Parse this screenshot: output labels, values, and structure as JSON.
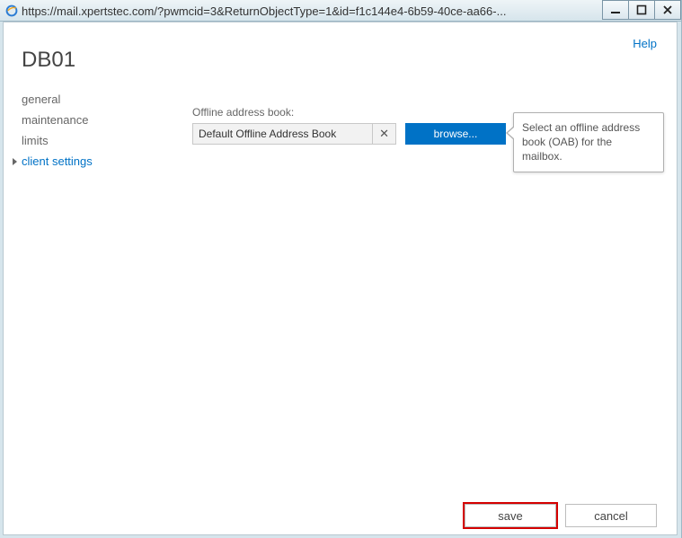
{
  "window": {
    "url": "https://mail.xpertstec.com/?pwmcid=3&ReturnObjectType=1&id=f1c144e4-6b59-40ce-aa66-..."
  },
  "help": {
    "label": "Help"
  },
  "page": {
    "title": "DB01"
  },
  "nav": {
    "items": [
      {
        "label": "general"
      },
      {
        "label": "maintenance"
      },
      {
        "label": "limits"
      },
      {
        "label": "client settings"
      }
    ]
  },
  "form": {
    "oab_field_label": "Offline address book:",
    "oab_value": "Default Offline Address Book",
    "browse_label": "browse..."
  },
  "callout": {
    "text": "Select an offline address book (OAB) for the mailbox."
  },
  "footer": {
    "save_label": "save",
    "cancel_label": "cancel"
  }
}
